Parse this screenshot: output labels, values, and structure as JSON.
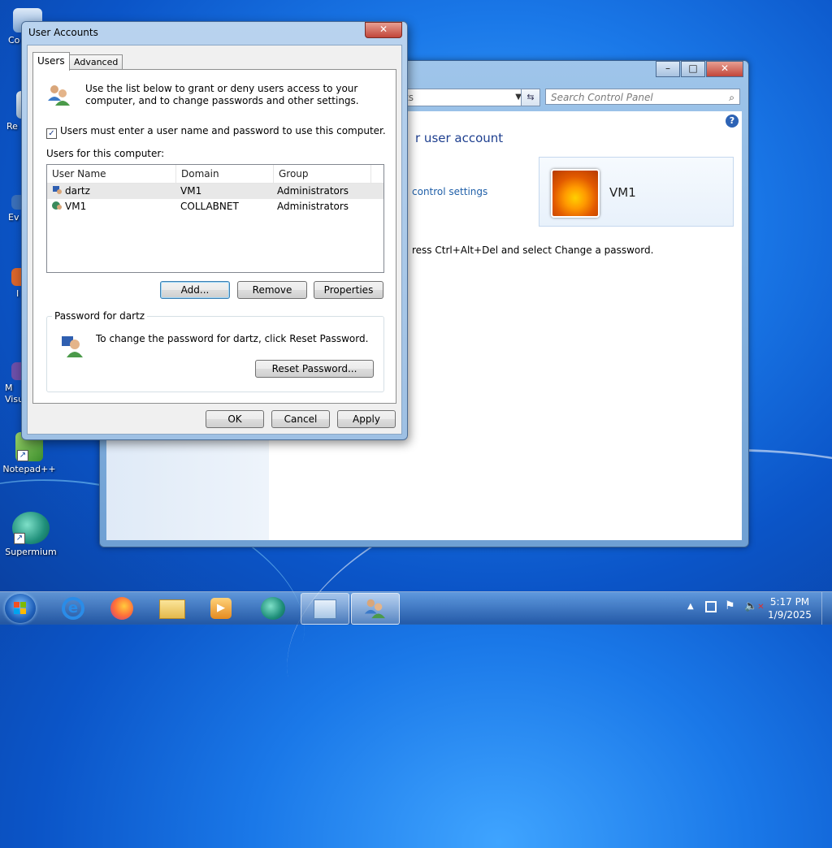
{
  "desktop": {
    "icons": [
      {
        "label": "Co"
      },
      {
        "label": "Re"
      },
      {
        "label": "Ev"
      },
      {
        "label": "I"
      },
      {
        "label": "M\nVisu"
      },
      {
        "label": "Notepad++"
      },
      {
        "label": "Supermium"
      }
    ]
  },
  "control_panel": {
    "address_text": "ts",
    "search_placeholder": "Search Control Panel",
    "heading": "r user account",
    "link": "control settings",
    "note": "ress Ctrl+Alt+Del and select Change a password.",
    "account_name": "VM1",
    "controls": {
      "minimize": "–",
      "maximize": "□",
      "close": "✕"
    }
  },
  "dialog": {
    "title": "User Accounts",
    "close": "✕",
    "tabs": [
      {
        "label": "Users"
      },
      {
        "label": "Advanced"
      }
    ],
    "intro": "Use the list below to grant or deny users access to your computer, and to change passwords and other settings.",
    "checkbox_label": "Users must enter a user name and password to use this computer.",
    "checkbox_checked": true,
    "users_label": "Users for this computer:",
    "columns": [
      "User Name",
      "Domain",
      "Group"
    ],
    "users": [
      {
        "name": "dartz",
        "domain": "VM1",
        "group": "Administrators"
      },
      {
        "name": "VM1",
        "domain": "COLLABNET",
        "group": "Administrators"
      }
    ],
    "buttons": {
      "add": "Add...",
      "remove": "Remove",
      "properties": "Properties"
    },
    "password_group_title": "Password for dartz",
    "password_text": "To change the password for dartz, click Reset Password.",
    "reset_button": "Reset Password...",
    "footer": {
      "ok": "OK",
      "cancel": "Cancel",
      "apply": "Apply"
    }
  },
  "taskbar": {
    "time": "5:17 PM",
    "date": "1/9/2025",
    "apps": [
      "start",
      "internet-explorer",
      "firefox",
      "file-explorer",
      "media-player",
      "supermium",
      "control-panel",
      "user-accounts"
    ]
  }
}
